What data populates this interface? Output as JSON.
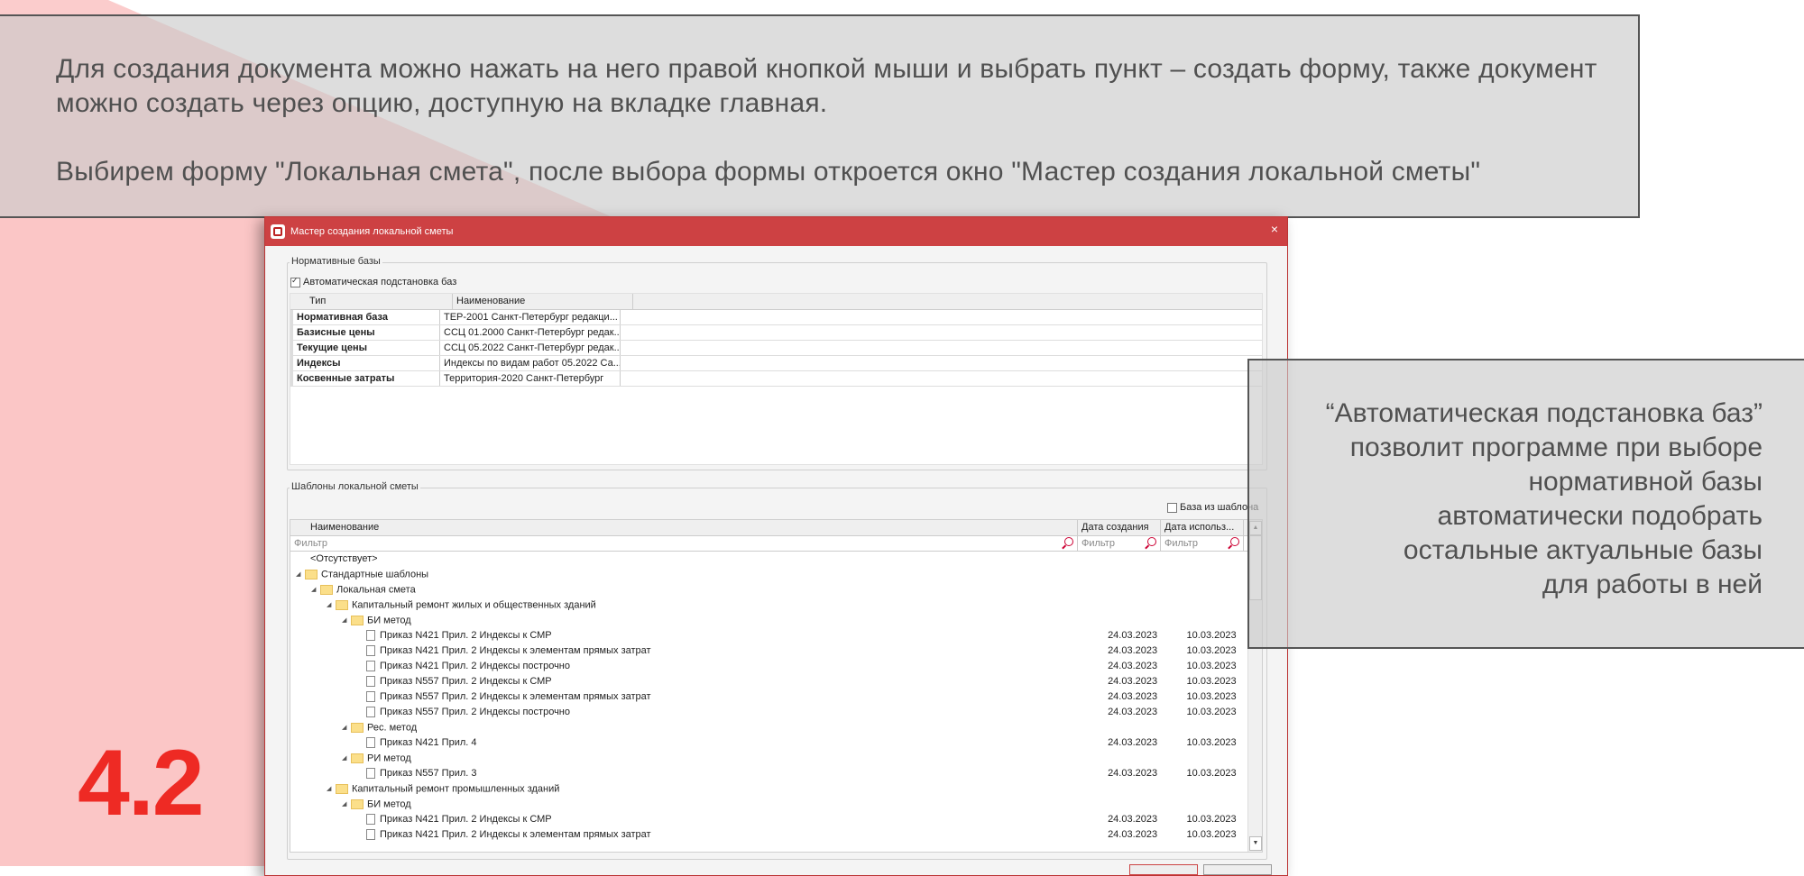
{
  "colors": {
    "accent": "#ee2a24",
    "title_bar": "#cd4143",
    "background_triangle": "#fbc6c6"
  },
  "callout_top": {
    "paragraph1": "Для создания документа можно нажать на него правой кнопкой мыши и выбрать пункт – создать форму, также документ можно создать через опцию, доступную на вкладке главная.",
    "paragraph2": "Выбирем форму \"Локальная смета\", после выбора формы откроется окно \"Мастер создания локальной сметы\""
  },
  "callout_right": {
    "lines": [
      "“Автоматическая подстановка баз”",
      "позволит программе при выборе",
      "нормативной базы",
      "автоматически подобрать",
      "остальные актуальные базы",
      "для работы в ней"
    ]
  },
  "section_number": "4.2",
  "dialog": {
    "title": "Мастер создания локальной сметы",
    "close_glyph": "×",
    "norm_bases": {
      "group_label": "Нормативные базы",
      "auto_checkbox_label": "Автоматическая подстановка баз",
      "auto_checked": true,
      "columns": [
        "Тип",
        "Наименование"
      ],
      "rows": [
        {
          "type": "Нормативная база",
          "name": "ТЕР-2001 Санкт-Петербург редакци..."
        },
        {
          "type": "Базисные цены",
          "name": "ССЦ 01.2000 Санкт-Петербург редак..."
        },
        {
          "type": "Текущие цены",
          "name": "ССЦ 05.2022 Санкт-Петербург редак..."
        },
        {
          "type": "Индексы",
          "name": "Индексы по видам работ 05.2022 Са..."
        },
        {
          "type": "Косвенные затраты",
          "name": "Территория-2020 Санкт-Петербург"
        }
      ]
    },
    "templates": {
      "group_label": "Шаблоны локальной сметы",
      "base_from_template_label": "База из шаблона",
      "columns": [
        "Наименование",
        "Дата создания",
        "Дата использ..."
      ],
      "filter_placeholder": "Фильтр",
      "rows": [
        {
          "level": 0,
          "kind": "none",
          "toggle": "",
          "name": "<Отсутствует>",
          "created": "",
          "used": ""
        },
        {
          "level": 0,
          "kind": "folder",
          "toggle": "◢",
          "name": "Стандартные шаблоны",
          "created": "",
          "used": ""
        },
        {
          "level": 1,
          "kind": "folder",
          "toggle": "◢",
          "name": "Локальная смета",
          "created": "",
          "used": ""
        },
        {
          "level": 2,
          "kind": "folder",
          "toggle": "◢",
          "name": "Капитальный ремонт жилых и общественных зданий",
          "created": "",
          "used": ""
        },
        {
          "level": 3,
          "kind": "folder",
          "toggle": "◢",
          "name": "БИ метод",
          "created": "",
          "used": ""
        },
        {
          "level": 4,
          "kind": "doc",
          "toggle": "",
          "name": "Приказ N421 Прил. 2 Индексы к СМР",
          "created": "24.03.2023",
          "used": "10.03.2023"
        },
        {
          "level": 4,
          "kind": "doc",
          "toggle": "",
          "name": "Приказ N421 Прил. 2 Индексы к элементам прямых затрат",
          "created": "24.03.2023",
          "used": "10.03.2023"
        },
        {
          "level": 4,
          "kind": "doc",
          "toggle": "",
          "name": "Приказ N421 Прил. 2 Индексы построчно",
          "created": "24.03.2023",
          "used": "10.03.2023"
        },
        {
          "level": 4,
          "kind": "doc",
          "toggle": "",
          "name": "Приказ N557 Прил. 2 Индексы к СМР",
          "created": "24.03.2023",
          "used": "10.03.2023"
        },
        {
          "level": 4,
          "kind": "doc",
          "toggle": "",
          "name": "Приказ N557 Прил. 2 Индексы к элементам прямых затрат",
          "created": "24.03.2023",
          "used": "10.03.2023"
        },
        {
          "level": 4,
          "kind": "doc",
          "toggle": "",
          "name": "Приказ N557 Прил. 2 Индексы построчно",
          "created": "24.03.2023",
          "used": "10.03.2023"
        },
        {
          "level": 3,
          "kind": "folder",
          "toggle": "◢",
          "name": "Рес. метод",
          "created": "",
          "used": ""
        },
        {
          "level": 4,
          "kind": "doc",
          "toggle": "",
          "name": "Приказ N421 Прил. 4",
          "created": "24.03.2023",
          "used": "10.03.2023"
        },
        {
          "level": 3,
          "kind": "folder",
          "toggle": "◢",
          "name": "РИ метод",
          "created": "",
          "used": ""
        },
        {
          "level": 4,
          "kind": "doc",
          "toggle": "",
          "name": "Приказ N557 Прил. 3",
          "created": "24.03.2023",
          "used": "10.03.2023"
        },
        {
          "level": 2,
          "kind": "folder",
          "toggle": "◢",
          "name": "Капитальный ремонт промышленных зданий",
          "created": "",
          "used": ""
        },
        {
          "level": 3,
          "kind": "folder",
          "toggle": "◢",
          "name": "БИ метод",
          "created": "",
          "used": ""
        },
        {
          "level": 4,
          "kind": "doc",
          "toggle": "",
          "name": "Приказ N421 Прил. 2 Индексы к СМР",
          "created": "24.03.2023",
          "used": "10.03.2023"
        },
        {
          "level": 4,
          "kind": "doc",
          "toggle": "",
          "name": "Приказ N421 Прил. 2 Индексы к элементам прямых затрат",
          "created": "24.03.2023",
          "used": "10.03.2023"
        }
      ]
    }
  }
}
